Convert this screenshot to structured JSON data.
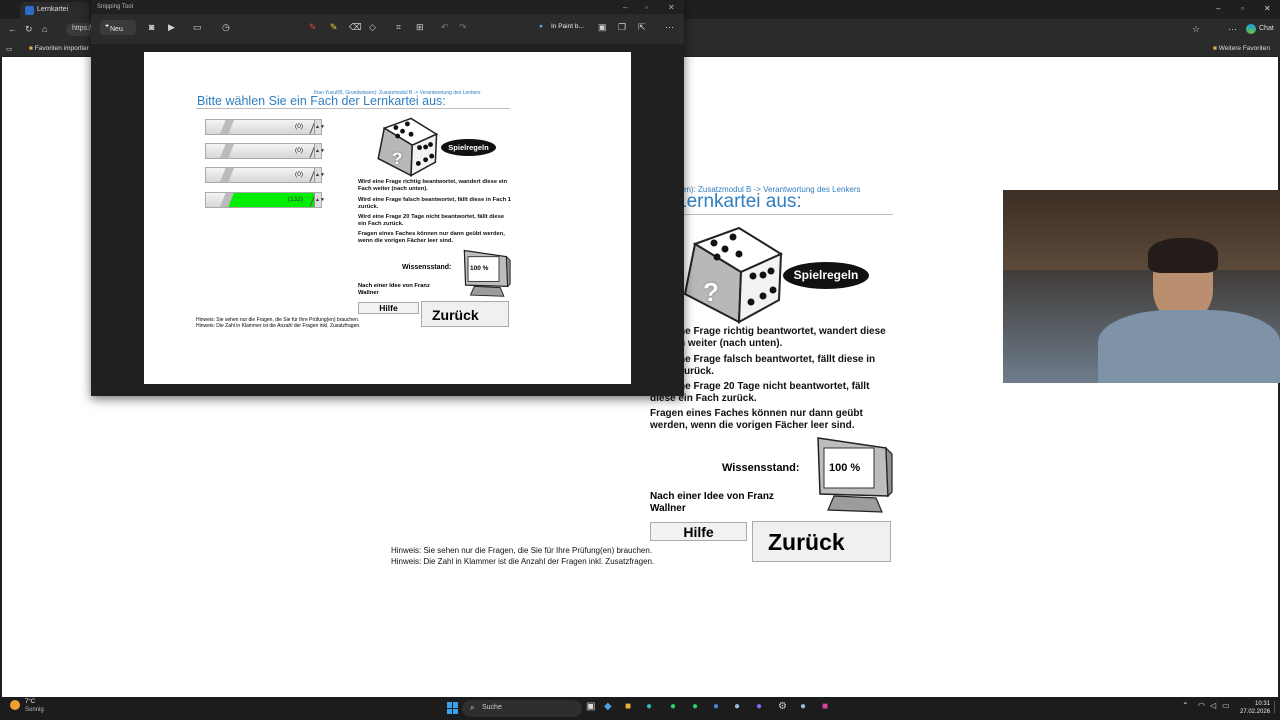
{
  "browser": {
    "tab_title": "Lernkartei",
    "address_text": "https:/",
    "favorites_import": "Favoriten importier",
    "other_favorites": "Weitere Favoriten",
    "chat_label": "Chat"
  },
  "snipping": {
    "title": "Snipping Tool",
    "new_label": "Neu",
    "paint_label": "In Paint b..."
  },
  "app": {
    "breadcrumb": "Ihan Yusuf(B, Grundwissen): Zusatzmodul B -> Verantwortung des Lenkers",
    "breadcrumb_visible": "sen): Zusatzmodul B -> Verantwortung des Lenkers",
    "heading": "Bitte wählen Sie ein Fach der Lernkartei aus:",
    "heading_visible": "Lernkartei aus:",
    "faecher": [
      {
        "label": "",
        "count": "(0)",
        "fill": 0
      },
      {
        "label": "",
        "count": "(0)",
        "fill": 0
      },
      {
        "label": "",
        "count": "(0)",
        "fill": 0
      },
      {
        "label": "",
        "count": "(132)",
        "fill": 1
      }
    ],
    "spielregeln": "Spielregeln",
    "dice_mark": "?",
    "rules": [
      "Wird eine Frage richtig beantwortet, wandert diese ein Fach weiter (nach unten).",
      "Wird eine Frage falsch beantwortet, fällt diese in Fach 1 zurück.",
      "Wird eine Frage 20 Tage nicht beantwortet, fällt diese ein Fach zurück.",
      "Fragen eines Faches können nur dann geübt werden, wenn die vorigen Fächer leer sind."
    ],
    "rules_visible": [
      "ne Frage richtig beantwortet, wandert diese",
      "h weiter (nach unten).",
      "ne Frage falsch beantwortet, fällt diese in",
      "zurück.",
      "ne Frage 20 Tage nicht beantwortet, fällt",
      "diese ein Fach zurück.",
      "Fragen eines Faches können nur dann geübt",
      "werden, wenn die vorigen Fächer leer sind."
    ],
    "wissensstand_label": "Wissensstand:",
    "wissensstand_value": "100 %",
    "idee": "Nach einer Idee von Franz Wallner",
    "idee_line1": "Nach einer Idee von Franz",
    "idee_line2": "Wallner",
    "hilfe": "Hilfe",
    "zurueck": "Zurück",
    "hinweis1": "Hinweis: Sie sehen nur die Fragen, die Sie für Ihre Prüfung(en) brauchen.",
    "hinweis2": "Hinweis: Die Zahl in Klammer ist die Anzahl der Fragen inkl. Zusatzfragen."
  },
  "taskbar": {
    "weather_temp": "7°C",
    "weather_desc": "Sonnig",
    "search_placeholder": "Suche",
    "time": "10:31",
    "date": "27.02.2026"
  },
  "colors": {
    "heading_blue": "#2f7fc1",
    "progress_green": "#00ee00",
    "taskbar": "#1c1c1c"
  }
}
